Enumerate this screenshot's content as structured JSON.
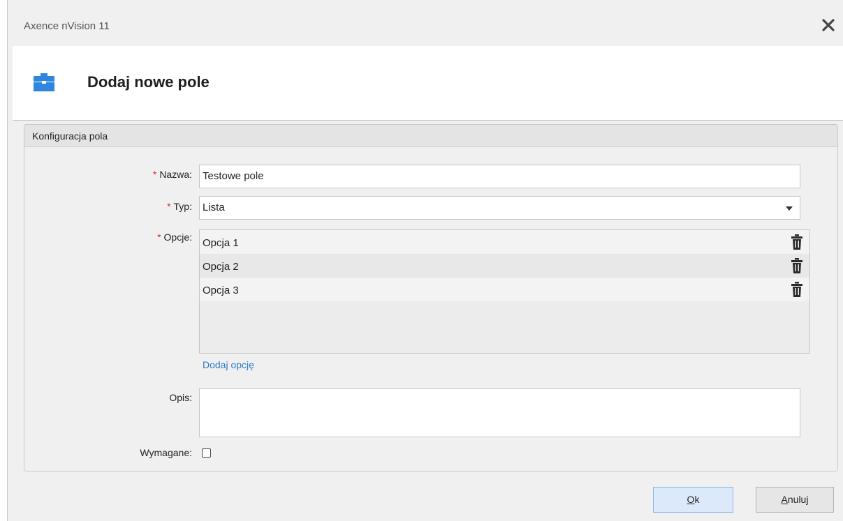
{
  "window": {
    "title": "Axence nVision 11"
  },
  "header": {
    "icon": "briefcase-icon",
    "title": "Dodaj nowe pole"
  },
  "panel": {
    "title": "Konfiguracja pola",
    "name_label": "Nazwa:",
    "name_value": "Testowe pole",
    "type_label": "Typ:",
    "type_value": "Lista",
    "options_label": "Opcje:",
    "options": [
      {
        "label": "Opcja 1"
      },
      {
        "label": "Opcja 2"
      },
      {
        "label": "Opcja 3"
      }
    ],
    "add_option_label": "Dodaj opcję",
    "description_label": "Opis:",
    "description_value": "",
    "required_label": "Wymagane:",
    "required_checked": false,
    "required_marker": "*"
  },
  "footer": {
    "ok_mnemonic": "O",
    "ok_rest": "k",
    "cancel_mnemonic": "A",
    "cancel_rest": "nuluj"
  },
  "colors": {
    "accent": "#2a7acb",
    "required": "#d32f2f",
    "ok_button_bg": "#dce9fa"
  }
}
